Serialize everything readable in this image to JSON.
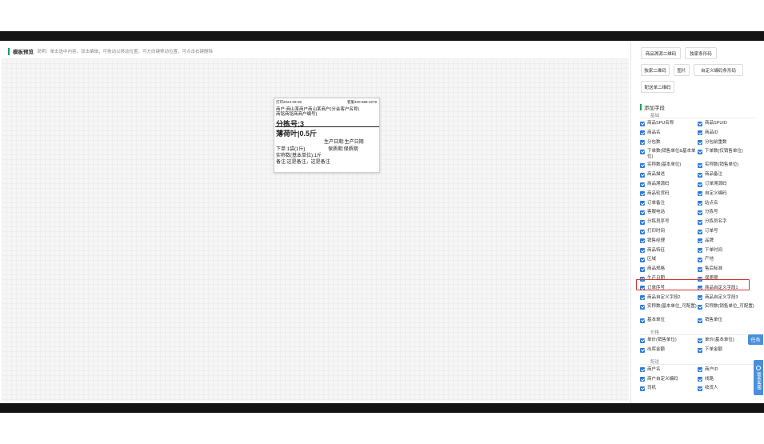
{
  "header": {
    "title": "模板预览",
    "desc": "说明：单击选中内容，双击编辑，可拖动以移动位置，可方向键移动位置，可点击右键删除"
  },
  "label": {
    "print_time": "打印2024-09-06",
    "phone": "客服400-888-3279",
    "merchant": "商户:商山某商户商山某商户(分会客户名称)",
    "merchant_code": "商铭商铭商商户编号)",
    "sort_no": "分拣号:3",
    "product": "薄荷叶|0.5斤",
    "production_date": "生产日期:生产日期",
    "order_qty": "下单:1袋(1斤)",
    "shelf_life": "保质期:保质期",
    "actual_qty": "实称数(基本单位):1斤",
    "note": "备注:这是备注，这是备注"
  },
  "right_panel": {
    "buttons": [
      "商品溯源二维码",
      "独家条形码",
      "独家二维码",
      "图片",
      "自定义编码条形码",
      "配送单二维码"
    ],
    "add_field_title": "添加字段",
    "groups": [
      {
        "title": "基础",
        "fields": [
          "商品SPU名称",
          "商品SPUID",
          "商品名",
          "商品ID",
          "分包数",
          "分包前重数",
          "下单数(销售单位&基本单位)",
          "下单数(仅销售单位)",
          "实称数(基本单位)",
          "实称数(销售单位)",
          "商品描述",
          "商品备注",
          "商品溯源码",
          "订单溯源码",
          "商品轮货码",
          "自定义编码",
          "订单备注",
          "站点名",
          "客服电话",
          "分拣号",
          "分拣员序号",
          "分拣员名字",
          "打印时间",
          "订单号",
          "销售经理",
          "品牌",
          "商品特征",
          "下单时间",
          "区域",
          "产地",
          "商品规格",
          "售后标准",
          "生产日期",
          "保质期",
          "订单序号",
          "商品自定义字段1",
          "商品自定义字段2",
          "商品自定义字段3",
          "实称数(基本单位_可配置)",
          "实称数(销售单位_可配置)",
          "基本单位",
          "销售单位"
        ]
      },
      {
        "title": "价格",
        "fields": [
          "单价(销售单位)",
          "单价(基本单位)",
          "出库金额",
          "下单金额"
        ]
      },
      {
        "title": "配送",
        "fields": [
          "商户名",
          "商户ID",
          "商户自定义编码",
          "线路",
          "司机",
          "收货人"
        ]
      }
    ],
    "highlighted_fields": [
      "生产日期",
      "保质期"
    ]
  },
  "float": {
    "task_label": "任务",
    "service_label": "联系客服"
  }
}
